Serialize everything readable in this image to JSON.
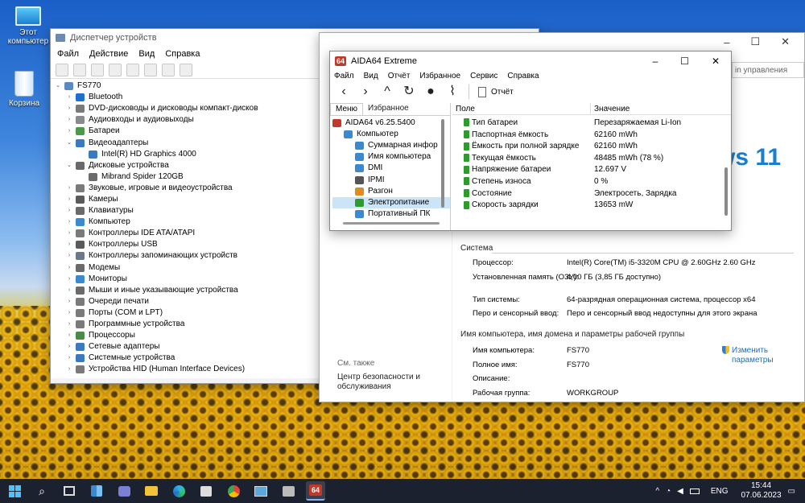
{
  "desktop": {
    "icons": [
      {
        "label_lines": [
          "Этот",
          "компьютер"
        ]
      },
      {
        "label_lines": [
          "Корзина"
        ]
      }
    ]
  },
  "devmgr": {
    "title": "Диспетчер устройств",
    "menu": [
      "Файл",
      "Действие",
      "Вид",
      "Справка"
    ],
    "root": "FS770",
    "items": [
      {
        "label": "Bluetooth",
        "level": 1,
        "exp": "›",
        "color": "#1e6fd0"
      },
      {
        "label": "DVD-дисководы и дисководы компакт-дисков",
        "level": 1,
        "exp": "›",
        "color": "#7a7a7a"
      },
      {
        "label": "Аудиовходы и аудиовыходы",
        "level": 1,
        "exp": "›",
        "color": "#8a8a8a"
      },
      {
        "label": "Батареи",
        "level": 1,
        "exp": "›",
        "color": "#4a9a4a"
      },
      {
        "label": "Видеоадаптеры",
        "level": 1,
        "exp": "⌄",
        "color": "#3a7ac0"
      },
      {
        "label": "Intel(R) HD Graphics 4000",
        "level": 2,
        "exp": "",
        "color": "#3a7ac0"
      },
      {
        "label": "Дисковые устройства",
        "level": 1,
        "exp": "⌄",
        "color": "#6a6a6a"
      },
      {
        "label": "Mibrand Spider 120GB",
        "level": 2,
        "exp": "",
        "color": "#6a6a6a"
      },
      {
        "label": "Звуковые, игровые и видеоустройства",
        "level": 1,
        "exp": "›",
        "color": "#7a7a7a"
      },
      {
        "label": "Камеры",
        "level": 1,
        "exp": "›",
        "color": "#5a5a5a"
      },
      {
        "label": "Клавиатуры",
        "level": 1,
        "exp": "›",
        "color": "#6a6a6a"
      },
      {
        "label": "Компьютер",
        "level": 1,
        "exp": "›",
        "color": "#3a8ad0"
      },
      {
        "label": "Контроллеры IDE ATA/ATAPI",
        "level": 1,
        "exp": "›",
        "color": "#7a7a7a"
      },
      {
        "label": "Контроллеры USB",
        "level": 1,
        "exp": "›",
        "color": "#5a5a5a"
      },
      {
        "label": "Контроллеры запоминающих устройств",
        "level": 1,
        "exp": "›",
        "color": "#6a7a8a"
      },
      {
        "label": "Модемы",
        "level": 1,
        "exp": "›",
        "color": "#6a6a6a"
      },
      {
        "label": "Мониторы",
        "level": 1,
        "exp": "›",
        "color": "#3a8ad0"
      },
      {
        "label": "Мыши и иные указывающие устройства",
        "level": 1,
        "exp": "›",
        "color": "#6a6a6a"
      },
      {
        "label": "Очереди печати",
        "level": 1,
        "exp": "›",
        "color": "#7a7a7a"
      },
      {
        "label": "Порты (COM и LPT)",
        "level": 1,
        "exp": "›",
        "color": "#7a7a7a"
      },
      {
        "label": "Программные устройства",
        "level": 1,
        "exp": "›",
        "color": "#7a7a7a"
      },
      {
        "label": "Процессоры",
        "level": 1,
        "exp": "›",
        "color": "#4a8a4a"
      },
      {
        "label": "Сетевые адаптеры",
        "level": 1,
        "exp": "›",
        "color": "#3a7ac0"
      },
      {
        "label": "Системные устройства",
        "level": 1,
        "exp": "›",
        "color": "#3a7ac0"
      },
      {
        "label": "Устройства HID (Human Interface Devices)",
        "level": 1,
        "exp": "›",
        "color": "#7a7a7a"
      }
    ]
  },
  "system": {
    "search_placeholder": "in управления",
    "brand": "ws 11",
    "section_system": "Система",
    "rows": [
      {
        "k": "Процессор:",
        "v": "Intel(R) Core(TM) i5-3320M CPU @ 2.60GHz   2.60 GHz"
      },
      {
        "k": "Установленная память (ОЗУ):",
        "v": "4,00 ГБ (3,85 ГБ доступно)"
      },
      {
        "k": "Тип системы:",
        "v": "64-разрядная операционная система, процессор x64"
      },
      {
        "k": "Перо и сенсорный ввод:",
        "v": "Перо и сенсорный ввод недоступны для этого экрана"
      }
    ],
    "section_name": "Имя компьютера, имя домена и параметры рабочей группы",
    "name_rows": [
      {
        "k": "Имя компьютера:",
        "v": "FS770"
      },
      {
        "k": "Полное имя:",
        "v": "FS770"
      },
      {
        "k": "Описание:",
        "v": ""
      },
      {
        "k": "Рабочая группа:",
        "v": "WORKGROUP"
      }
    ],
    "change_line1": "Изменить",
    "change_line2": "параметры",
    "see_also": "См. также",
    "security_line1": "Центр безопасности и",
    "security_line2": "обслуживания"
  },
  "aida": {
    "logo": "64",
    "title": "AIDA64 Extreme",
    "menu": [
      "Файл",
      "Вид",
      "Отчёт",
      "Избранное",
      "Сервис",
      "Справка"
    ],
    "report_label": "Отчёт",
    "tab_menu": "Меню",
    "tab_favorites": "Избранное",
    "tree": [
      {
        "label": "AIDA64 v6.25.5400",
        "level": 0,
        "color": "#c0392b"
      },
      {
        "label": "Компьютер",
        "level": 1,
        "color": "#3a8ad0"
      },
      {
        "label": "Суммарная инфор",
        "level": 2,
        "color": "#3a8ad0"
      },
      {
        "label": "Имя компьютера",
        "level": 2,
        "color": "#3a8ad0"
      },
      {
        "label": "DMI",
        "level": 2,
        "color": "#3a8ad0"
      },
      {
        "label": "IPMI",
        "level": 2,
        "color": "#555"
      },
      {
        "label": "Разгон",
        "level": 2,
        "color": "#e08a20"
      },
      {
        "label": "Электропитание",
        "level": 2,
        "color": "#2f9b2f"
      },
      {
        "label": "Портативный ПК",
        "level": 2,
        "color": "#3a8ad0"
      }
    ],
    "col_field": "Поле",
    "col_value": "Значение",
    "rows": [
      {
        "field": "Тип батареи",
        "value": "Перезаряжаемая Li-Ion"
      },
      {
        "field": "Паспортная ёмкость",
        "value": "62160 mWh"
      },
      {
        "field": "Ёмкость при полной зарядке",
        "value": "62160 mWh"
      },
      {
        "field": "Текущая ёмкость",
        "value": "48485 mWh  (78 %)"
      },
      {
        "field": "Напряжение батареи",
        "value": "12.697 V"
      },
      {
        "field": "Степень износа",
        "value": "0 %"
      },
      {
        "field": "Состояние",
        "value": "Электросеть, Зарядка"
      },
      {
        "field": "Скорость зарядки",
        "value": "13653 mW"
      }
    ]
  },
  "taskbar": {
    "lang": "ENG",
    "time": "15:44",
    "date": "07.06.2023",
    "app_label": "64"
  }
}
